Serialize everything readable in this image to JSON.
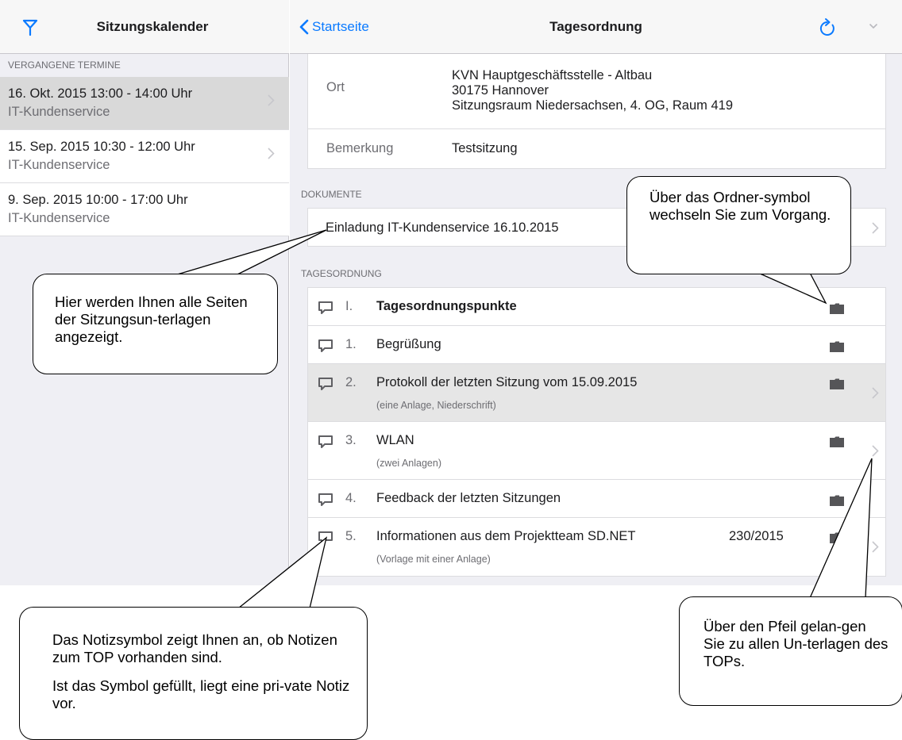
{
  "left": {
    "title": "Sitzungskalender",
    "section_header": "VERGANGENE TERMINE",
    "meetings": [
      {
        "date": "16. Okt. 2015 13:00 - 14:00 Uhr",
        "org": "IT-Kundenservice",
        "selected": true
      },
      {
        "date": "15. Sep. 2015 10:30 - 12:00 Uhr",
        "org": "IT-Kundenservice",
        "selected": false
      },
      {
        "date": "9. Sep. 2015 10:00 - 17:00 Uhr",
        "org": "IT-Kundenservice",
        "selected": false
      }
    ]
  },
  "right": {
    "back_label": "Startseite",
    "title": "Tagesordnung",
    "info": {
      "ort_label": "Ort",
      "ort_value_line1": "KVN Hauptgeschäftsstelle - Altbau",
      "ort_value_line2": "30175 Hannover",
      "ort_value_line3": "Sitzungsraum Niedersachsen, 4. OG, Raum 419",
      "bemerkung_label": "Bemerkung",
      "bemerkung_value": "Testsitzung"
    },
    "documents_header": "DOKUMENTE",
    "document_title": "Einladung IT-Kundenservice 16.10.2015",
    "agenda_header": "TAGESORDNUNG",
    "agenda": [
      {
        "number": "I.",
        "title": "Tagesordnungspunkte",
        "subtitle": "",
        "ref": ""
      },
      {
        "number": "1.",
        "title": "Begrüßung",
        "subtitle": "",
        "ref": ""
      },
      {
        "number": "2.",
        "title": "Protokoll der letzten Sitzung vom 15.09.2015",
        "subtitle": "(eine Anlage, Niederschrift)",
        "ref": ""
      },
      {
        "number": "3.",
        "title": "WLAN",
        "subtitle": "(zwei Anlagen)",
        "ref": ""
      },
      {
        "number": "4.",
        "title": "Feedback der letzten Sitzungen",
        "subtitle": "",
        "ref": ""
      },
      {
        "number": "5.",
        "title": "Informationen aus  dem Projektteam SD.NET",
        "subtitle": "(Vorlage mit einer Anlage)",
        "ref": "230/2015"
      }
    ]
  },
  "callouts": {
    "documents": "Hier werden Ihnen alle Seiten der Sitzungsun-terlagen angezeigt.",
    "folder": "Über das Ordner-symbol wechseln Sie zum Vorgang.",
    "note_p1": "Das Notizsymbol zeigt Ihnen an, ob Notizen zum TOP vorhanden sind.",
    "note_p2": "Ist das Symbol gefüllt, liegt eine pri-vate Notiz vor.",
    "arrow": "Über den Pfeil gelan-gen Sie zu allen Un-terlagen des TOPs."
  },
  "colors": {
    "accent": "#0a7aff",
    "background": "#efeff4",
    "selected": "#d9d9d9"
  }
}
